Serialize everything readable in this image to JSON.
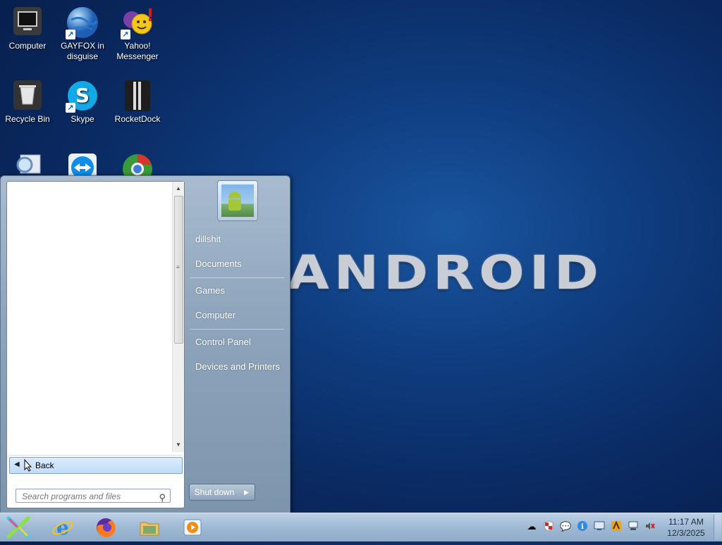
{
  "wallpaper": {
    "logo_text": "ANDROID"
  },
  "desktop": {
    "icons": [
      {
        "label": "Computer"
      },
      {
        "label": "GAYFOX in disguise"
      },
      {
        "label": "Yahoo! Messenger"
      },
      {
        "label": "Recycle Bin"
      },
      {
        "label": "Skype"
      },
      {
        "label": "RocketDock"
      }
    ]
  },
  "start_menu": {
    "back_label": "Back",
    "search_placeholder": "Search programs and files",
    "right_items": [
      "dillshit",
      "Documents",
      "Games",
      "Computer",
      "Control Panel",
      "Devices and Printers"
    ],
    "shutdown_label": "Shut down"
  },
  "taskbar": {
    "pinned": [
      "internet-explorer-icon",
      "firefox-icon",
      "file-explorer-icon",
      "media-player-icon"
    ],
    "tray_icons": [
      "network-icon",
      "security-icon",
      "chat-icon",
      "info-icon",
      "display-icon",
      "app-icon",
      "computer-icon",
      "volume-muted-icon"
    ],
    "clock_time": "11:17 AM",
    "clock_date": "12/3/2025"
  },
  "colors": {
    "desktop_bg": "#0f3d80",
    "taskbar": "#9fb9d4",
    "start_menu": "#8fa6bd",
    "accent": "#1b64c8"
  }
}
